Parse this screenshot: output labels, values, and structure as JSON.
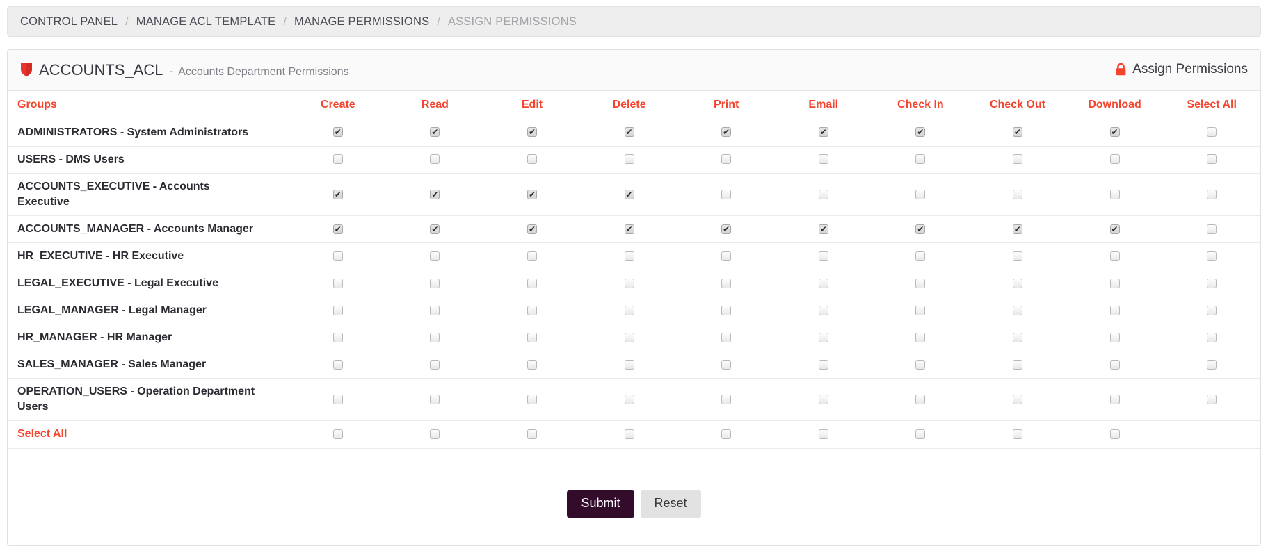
{
  "breadcrumb": {
    "separator": "/",
    "items": [
      {
        "label": "CONTROL PANEL",
        "active": false
      },
      {
        "label": "MANAGE ACL TEMPLATE",
        "active": false
      },
      {
        "label": "MANAGE PERMISSIONS",
        "active": false
      },
      {
        "label": "ASSIGN PERMISSIONS",
        "active": true
      }
    ]
  },
  "panel": {
    "icon": "shield-icon",
    "acl_name": "ACCOUNTS_ACL",
    "dash": "-",
    "acl_description": "Accounts Department Permissions",
    "action_icon": "lock-icon",
    "action_label": "Assign Permissions"
  },
  "colors": {
    "accent_red": "#f4442e",
    "shield_red": "#e8342a",
    "lock_red": "#f4442e",
    "submit_bg": "#330b2b",
    "reset_bg": "#e2e2e2",
    "breadcrumb_bg": "#eeeeee"
  },
  "table": {
    "columns": [
      "Groups",
      "Create",
      "Read",
      "Edit",
      "Delete",
      "Print",
      "Email",
      "Check In",
      "Check Out",
      "Download",
      "Select All"
    ],
    "rows": [
      {
        "group": "ADMINISTRATORS - System Administrators",
        "checks": [
          true,
          true,
          true,
          true,
          true,
          true,
          true,
          true,
          true,
          false
        ]
      },
      {
        "group": "USERS - DMS Users",
        "checks": [
          false,
          false,
          false,
          false,
          false,
          false,
          false,
          false,
          false,
          false
        ]
      },
      {
        "group": "ACCOUNTS_EXECUTIVE - Accounts Executive",
        "checks": [
          true,
          true,
          true,
          true,
          false,
          false,
          false,
          false,
          false,
          false
        ]
      },
      {
        "group": "ACCOUNTS_MANAGER - Accounts Manager",
        "checks": [
          true,
          true,
          true,
          true,
          true,
          true,
          true,
          true,
          true,
          false
        ]
      },
      {
        "group": "HR_EXECUTIVE - HR Executive",
        "checks": [
          false,
          false,
          false,
          false,
          false,
          false,
          false,
          false,
          false,
          false
        ]
      },
      {
        "group": "LEGAL_EXECUTIVE - Legal Executive",
        "checks": [
          false,
          false,
          false,
          false,
          false,
          false,
          false,
          false,
          false,
          false
        ]
      },
      {
        "group": "LEGAL_MANAGER - Legal Manager",
        "checks": [
          false,
          false,
          false,
          false,
          false,
          false,
          false,
          false,
          false,
          false
        ]
      },
      {
        "group": "HR_MANAGER - HR Manager",
        "checks": [
          false,
          false,
          false,
          false,
          false,
          false,
          false,
          false,
          false,
          false
        ]
      },
      {
        "group": "SALES_MANAGER - Sales Manager",
        "checks": [
          false,
          false,
          false,
          false,
          false,
          false,
          false,
          false,
          false,
          false
        ]
      },
      {
        "group": "OPERATION_USERS - Operation Department Users",
        "checks": [
          false,
          false,
          false,
          false,
          false,
          false,
          false,
          false,
          false,
          false
        ]
      }
    ],
    "footer_row": {
      "label": "Select All",
      "checks": [
        false,
        false,
        false,
        false,
        false,
        false,
        false,
        false,
        false
      ]
    }
  },
  "buttons": {
    "submit_label": "Submit",
    "reset_label": "Reset"
  }
}
